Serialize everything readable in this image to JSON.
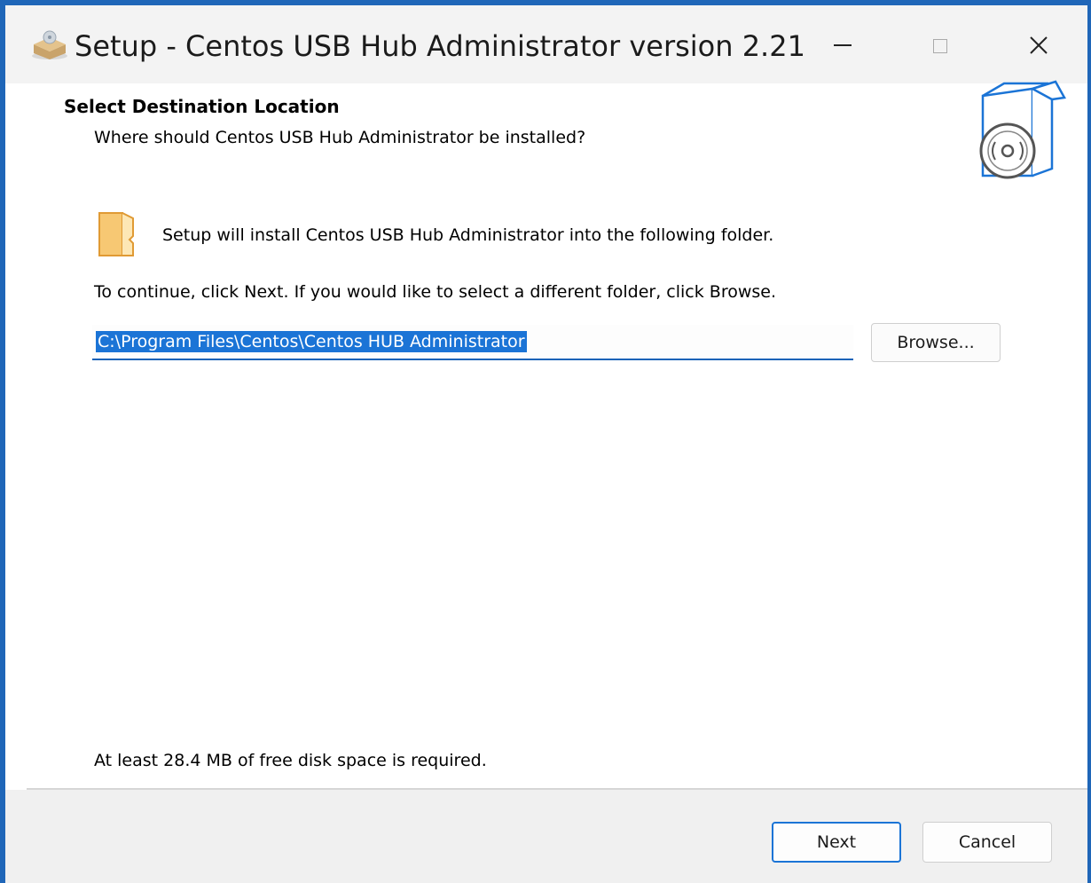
{
  "window": {
    "title": "Setup - Centos USB Hub Administrator version 2.21"
  },
  "header": {
    "title": "Select Destination Location",
    "subtitle": "Where should Centos USB Hub Administrator be installed?"
  },
  "content": {
    "install_text": "Setup will install Centos USB Hub Administrator into the following folder.",
    "continue_text": "To continue, click Next. If you would like to select a different folder, click Browse.",
    "path_value": "C:\\Program Files\\Centos\\Centos HUB Administrator",
    "browse_label": "Browse...",
    "disk_space_text": "At least 28.4 MB of free disk space is required."
  },
  "footer": {
    "next_label": "Next",
    "cancel_label": "Cancel"
  },
  "icons": {
    "app": "installer-box-icon",
    "box": "software-box-cd-icon",
    "folder": "folder-icon",
    "minimize": "minimize-icon",
    "maximize": "maximize-icon",
    "close": "close-icon"
  },
  "colors": {
    "accent": "#1b74d6",
    "border": "#1f66b8"
  }
}
